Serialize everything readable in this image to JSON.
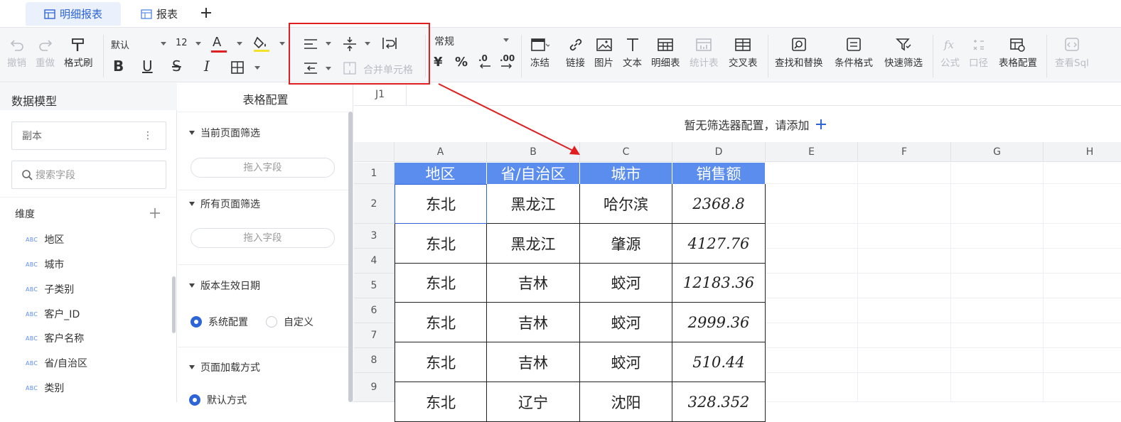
{
  "tabs": [
    {
      "label": "明细报表",
      "active": true
    },
    {
      "label": "报表",
      "active": false
    }
  ],
  "toolbar": {
    "undo": "撤销",
    "redo": "重做",
    "format_painter": "格式刷",
    "font_family": "默认",
    "font_size": "12",
    "merge_cells": "合并单元格",
    "number_format": "常规",
    "freeze": "冻结",
    "link": "链接",
    "image": "图片",
    "text": "文本",
    "detail_table": "明细表",
    "stat_table": "统计表",
    "cross_table": "交叉表",
    "find_replace": "查找和替换",
    "cond_format": "条件格式",
    "quick_filter": "快速筛选",
    "formula": "公式",
    "caliber": "口径",
    "table_config": "表格配置",
    "view_sql": "查看Sql",
    "bold": "B",
    "underline": "U",
    "strike": "S",
    "italic": "I",
    "yen": "¥",
    "percent": "%",
    "dec_less": ".0",
    "dec_more": ".00",
    "font_color_glyph": "A"
  },
  "colors": {
    "accent": "#2d64d8",
    "header_fill": "#5b8def",
    "highlight": "#e02020"
  },
  "left_panel": {
    "title": "数据模型",
    "dataset": "副本",
    "search_placeholder": "搜索字段",
    "dimension_label": "维度",
    "abc": "ABC",
    "fields": [
      "地区",
      "城市",
      "子类别",
      "客户_ID",
      "客户名称",
      "省/自治区",
      "类别"
    ]
  },
  "config_panel": {
    "title": "表格配置",
    "sections": [
      "当前页面筛选",
      "所有页面筛选",
      "版本生效日期",
      "页面加载方式"
    ],
    "drop_field": "拖入字段",
    "radio_system": "系统配置",
    "radio_custom": "自定义",
    "radio_default": "默认方式"
  },
  "sheet": {
    "cell_ref": "J1",
    "filter_hint": "暂无筛选器配置，请添加",
    "columns": [
      "A",
      "B",
      "C",
      "D",
      "E",
      "F",
      "G",
      "H"
    ],
    "rows": [
      "1",
      "2",
      "3",
      "4",
      "5",
      "6",
      "7",
      "8",
      "9"
    ],
    "headers": [
      "地区",
      "省/自治区",
      "城市",
      "销售额"
    ],
    "data": [
      [
        "东北",
        "黑龙江",
        "哈尔滨",
        "2368.8"
      ],
      [
        "东北",
        "黑龙江",
        "肇源",
        "4127.76"
      ],
      [
        "东北",
        "吉林",
        "蛟河",
        "12183.36"
      ],
      [
        "东北",
        "吉林",
        "蛟河",
        "2999.36"
      ],
      [
        "东北",
        "吉林",
        "蛟河",
        "510.44"
      ],
      [
        "东北",
        "辽宁",
        "沈阳",
        "328.352"
      ]
    ]
  }
}
